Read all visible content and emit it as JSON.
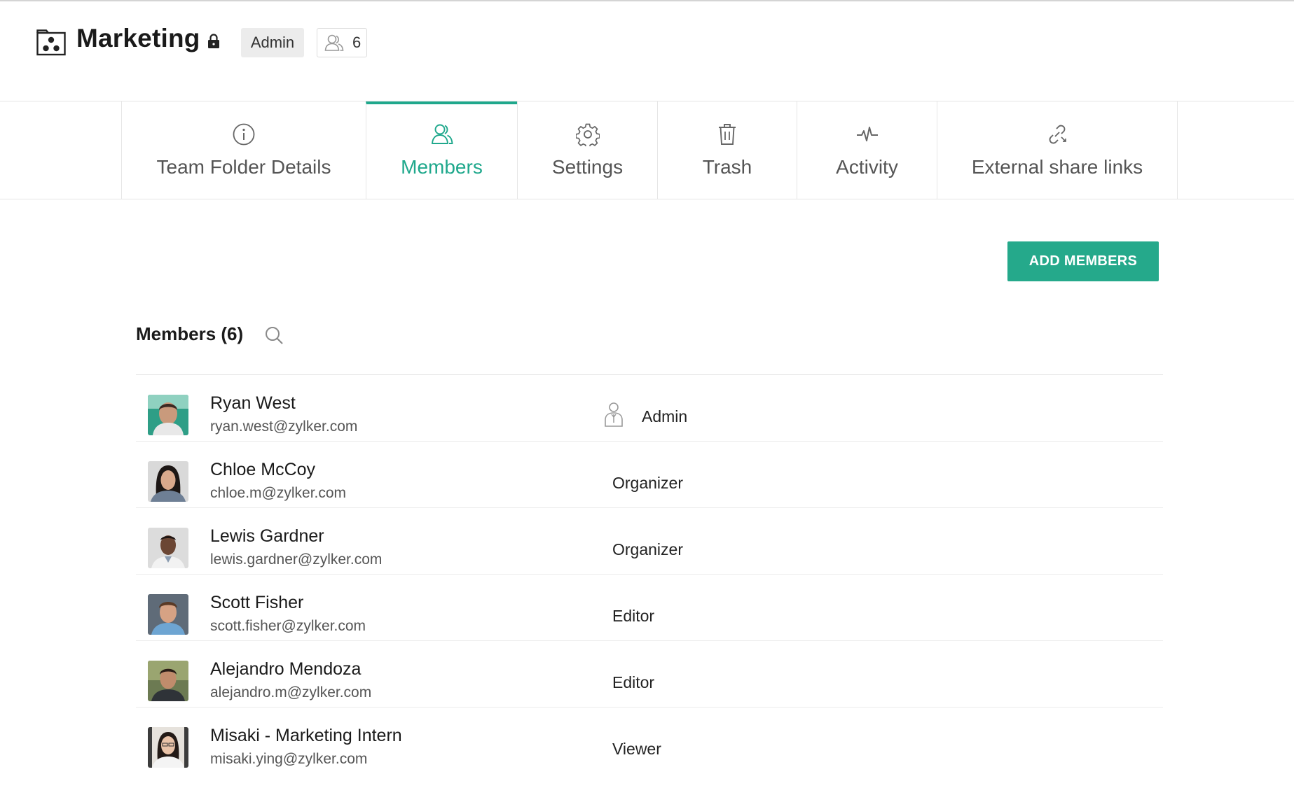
{
  "header": {
    "folder_title": "Marketing",
    "role_badge": "Admin",
    "member_count": "6",
    "icons": [
      "team-folder-icon",
      "lock-icon",
      "users-icon"
    ]
  },
  "tabs": [
    {
      "id": "details",
      "label": "Team Folder Details",
      "icon": "info-icon",
      "active": false
    },
    {
      "id": "members",
      "label": "Members",
      "icon": "members-icon",
      "active": true
    },
    {
      "id": "settings",
      "label": "Settings",
      "icon": "gear-icon",
      "active": false
    },
    {
      "id": "trash",
      "label": "Trash",
      "icon": "trash-icon",
      "active": false
    },
    {
      "id": "activity",
      "label": "Activity",
      "icon": "activity-icon",
      "active": false
    },
    {
      "id": "share",
      "label": "External share links",
      "icon": "link-icon",
      "active": false
    }
  ],
  "actions": {
    "add_members_label": "ADD MEMBERS"
  },
  "members_section": {
    "heading": "Members (6)"
  },
  "members": [
    {
      "name": "Ryan West",
      "email": "ryan.west@zylker.com",
      "role": "Admin",
      "role_icon": "admin-user-icon"
    },
    {
      "name": "Chloe McCoy",
      "email": "chloe.m@zylker.com",
      "role": "Organizer"
    },
    {
      "name": "Lewis Gardner",
      "email": "lewis.gardner@zylker.com",
      "role": "Organizer"
    },
    {
      "name": "Scott Fisher",
      "email": "scott.fisher@zylker.com",
      "role": "Editor"
    },
    {
      "name": "Alejandro Mendoza",
      "email": "alejandro.m@zylker.com",
      "role": "Editor"
    },
    {
      "name": "Misaki - Marketing Intern",
      "email": "misaki.ying@zylker.com",
      "role": "Viewer"
    }
  ],
  "colors": {
    "accent": "#1fa88c",
    "button": "#25a98b",
    "text_primary": "#1a1a1a",
    "text_secondary": "#555555"
  }
}
